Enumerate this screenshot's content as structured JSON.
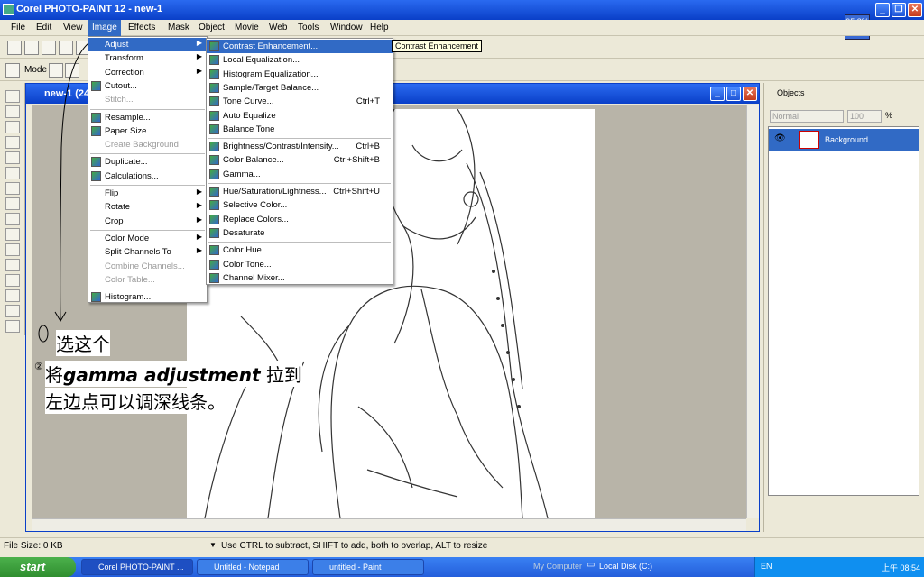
{
  "window": {
    "title": "Corel PHOTO-PAINT 12 - new-1",
    "zoom": "95.8%"
  },
  "menubar": [
    "File",
    "Edit",
    "View",
    "Image",
    "Effects",
    "Mask",
    "Object",
    "Movie",
    "Web",
    "Tools",
    "Window",
    "Help"
  ],
  "toolbar2": {
    "mode_label": "Mode"
  },
  "image_menu": [
    {
      "label": "Adjust",
      "arrow": true,
      "hl": true
    },
    {
      "label": "Transform",
      "arrow": true
    },
    {
      "label": "Correction",
      "arrow": true
    },
    {
      "label": "Cutout...",
      "icon": true
    },
    {
      "label": "Stitch...",
      "dis": true,
      "sepAfter": true
    },
    {
      "label": "Resample...",
      "icon": true
    },
    {
      "label": "Paper Size...",
      "icon": true
    },
    {
      "label": "Create Background",
      "dis": true,
      "sepAfter": true
    },
    {
      "label": "Duplicate...",
      "icon": true
    },
    {
      "label": "Calculations...",
      "icon": true,
      "sepAfter": true
    },
    {
      "label": "Flip",
      "arrow": true
    },
    {
      "label": "Rotate",
      "arrow": true
    },
    {
      "label": "Crop",
      "arrow": true,
      "sepAfter": true
    },
    {
      "label": "Color Mode",
      "arrow": true
    },
    {
      "label": "Split Channels To",
      "arrow": true
    },
    {
      "label": "Combine Channels...",
      "dis": true
    },
    {
      "label": "Color Table...",
      "dis": true,
      "sepAfter": true
    },
    {
      "label": "Histogram...",
      "icon": true
    }
  ],
  "adjust_menu": [
    {
      "label": "Contrast Enhancement...",
      "hl": true
    },
    {
      "label": "Local Equalization..."
    },
    {
      "label": "Histogram Equalization..."
    },
    {
      "label": "Sample/Target Balance..."
    },
    {
      "label": "Tone Curve...",
      "sc": "Ctrl+T"
    },
    {
      "label": "Auto Equalize"
    },
    {
      "label": "Balance Tone",
      "sepAfter": true
    },
    {
      "label": "Brightness/Contrast/Intensity...",
      "sc": "Ctrl+B"
    },
    {
      "label": "Color Balance...",
      "sc": "Ctrl+Shift+B"
    },
    {
      "label": "Gamma...",
      "sepAfter": true
    },
    {
      "label": "Hue/Saturation/Lightness...",
      "sc": "Ctrl+Shift+U"
    },
    {
      "label": "Selective Color..."
    },
    {
      "label": "Replace Colors..."
    },
    {
      "label": "Desaturate",
      "sepAfter": true
    },
    {
      "label": "Color Hue..."
    },
    {
      "label": "Color Tone..."
    },
    {
      "label": "Channel Mixer..."
    }
  ],
  "tooltip": "Contrast Enhancement",
  "doc": {
    "title": "new-1 (24"
  },
  "objects": {
    "title": "Objects",
    "blend": "Normal",
    "opacity": "100",
    "unit": "%",
    "layer": "Background"
  },
  "annotation": {
    "line1": "选这个",
    "line2a": "将",
    "line2b": "gamma adjustment",
    "line2c": " 拉到",
    "line3": "左边点可以调深线条。"
  },
  "status": {
    "size": "File Size: 0 KB",
    "hint": "Use CTRL to subtract, SHIFT to add, both to overlap, ALT to resize"
  },
  "taskbar": {
    "start": "start",
    "tasks": [
      "Corel PHOTO-PAINT ...",
      "Untitled - Notepad",
      "untitled - Paint"
    ],
    "mycomputer": "My Computer",
    "localdisk": "Local Disk (C:)",
    "lang": "EN",
    "clock": "上午 08:54"
  }
}
